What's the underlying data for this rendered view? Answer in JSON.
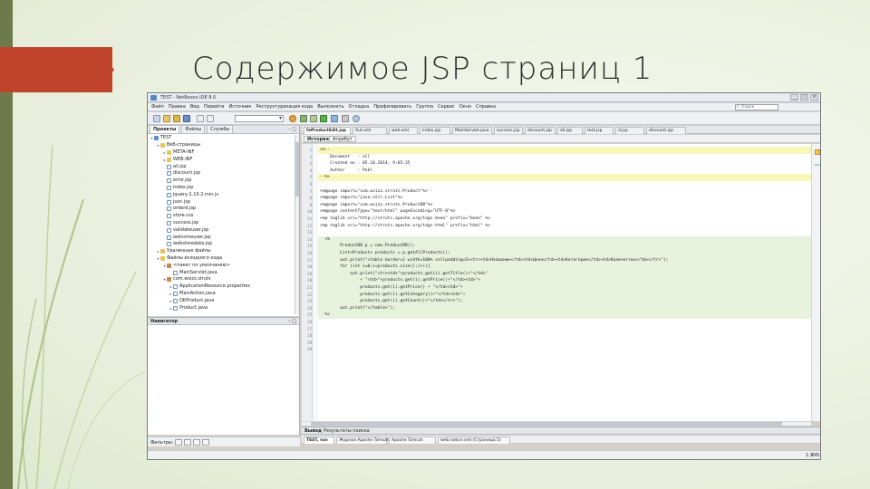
{
  "slide": {
    "title": "Содержимое JSP страниц 1",
    "accent_color": "#c0442b",
    "background_color": "#ecf1e0"
  },
  "ide": {
    "window_title": "TEST - NetBeans IDE 8.0",
    "menu": [
      "Файл",
      "Правка",
      "Вид",
      "Перейти",
      "Источник",
      "Реструктуризация кода",
      "Выполнить",
      "Отладка",
      "Профилировать",
      "Группа",
      "Сервис",
      "Окно",
      "Справка"
    ],
    "search_placeholder": "Поиск",
    "window_buttons": [
      "_",
      "□",
      "×"
    ],
    "left_tabs": [
      "Проекты",
      "Файлы",
      "Службы"
    ],
    "tree": [
      {
        "indent": 0,
        "twisty": "▾",
        "icon": "proj",
        "label": "TEST"
      },
      {
        "indent": 1,
        "twisty": "▾",
        "icon": "folder",
        "label": "Веб-страницы"
      },
      {
        "indent": 2,
        "twisty": "▸",
        "icon": "folder",
        "label": "META-INF"
      },
      {
        "indent": 2,
        "twisty": "▸",
        "icon": "folder",
        "label": "WEB-INF"
      },
      {
        "indent": 2,
        "twisty": "",
        "icon": "file",
        "label": "all.jsp"
      },
      {
        "indent": 2,
        "twisty": "",
        "icon": "file",
        "label": "discount.jsp"
      },
      {
        "indent": 2,
        "twisty": "",
        "icon": "file",
        "label": "error.jsp"
      },
      {
        "indent": 2,
        "twisty": "",
        "icon": "file",
        "label": "index.jsp"
      },
      {
        "indent": 2,
        "twisty": "",
        "icon": "file",
        "label": "jquery-1.10.2.min.js"
      },
      {
        "indent": 2,
        "twisty": "",
        "icon": "file",
        "label": "json.jsp"
      },
      {
        "indent": 2,
        "twisty": "",
        "icon": "file",
        "label": "orderd.jsp"
      },
      {
        "indent": 2,
        "twisty": "",
        "icon": "file",
        "label": "store.css"
      },
      {
        "indent": 2,
        "twisty": "",
        "icon": "file",
        "label": "success.jsp"
      },
      {
        "indent": 2,
        "twisty": "",
        "icon": "file",
        "label": "validateuser.jsp"
      },
      {
        "indent": 2,
        "twisty": "",
        "icon": "file",
        "label": "welcomeuser.jsp"
      },
      {
        "indent": 2,
        "twisty": "",
        "icon": "file",
        "label": "webstoredata.jsp"
      },
      {
        "indent": 1,
        "twisty": "▸",
        "icon": "folder",
        "label": "Удаленные файлы"
      },
      {
        "indent": 1,
        "twisty": "▾",
        "icon": "folder",
        "label": "Файлы исходного кода"
      },
      {
        "indent": 2,
        "twisty": "▾",
        "icon": "pkg",
        "label": "<пакет по умолчанию>"
      },
      {
        "indent": 3,
        "twisty": "",
        "icon": "file",
        "label": "MainServlet.java"
      },
      {
        "indent": 2,
        "twisty": "▾",
        "icon": "pkg",
        "label": "com.wsizz.struts"
      },
      {
        "indent": 3,
        "twisty": "▸",
        "icon": "file",
        "label": "ApplicationResource.properties"
      },
      {
        "indent": 3,
        "twisty": "▸",
        "icon": "file",
        "label": "MainAction.java"
      },
      {
        "indent": 3,
        "twisty": "▸",
        "icon": "file",
        "label": "OKProduct.java"
      },
      {
        "indent": 3,
        "twisty": "▸",
        "icon": "file",
        "label": "Product.java"
      }
    ],
    "navigator_title": "Навигатор",
    "filter_label": "Фильтры:",
    "editor_tabs": [
      "feProductEdit.jsp",
      "Aut.xml",
      "web.xml",
      "index.jsp",
      "MainServlet.java",
      "success.jsp",
      "discount.jsp",
      "all.jsp",
      "test.jsp",
      "d.jsp",
      "discount.jsp"
    ],
    "editor_view_tabs": [
      "История",
      "Атрибут"
    ],
    "line_numbers": [
      "1",
      "2",
      "3",
      "4",
      "5",
      "6",
      "7",
      "8",
      "9",
      "10",
      "11",
      "12",
      "13",
      "14",
      "15",
      "16",
      "17",
      "18",
      "19",
      "20",
      "21",
      "22",
      "23",
      "24",
      "25",
      "26",
      "27",
      "28",
      "29",
      "30"
    ],
    "code_lines": [
      {
        "text": "<%--",
        "cls": "hl-yellow"
      },
      {
        "text": "    Document   : all",
        "cls": ""
      },
      {
        "text": "    Created on : 05.10.2014, 9:05:35",
        "cls": ""
      },
      {
        "text": "    Author     : Pekl",
        "cls": ""
      },
      {
        "text": "--%>",
        "cls": "hl-yellow"
      },
      {
        "text": "",
        "cls": ""
      },
      {
        "text": "<%@page import=\"com.wsizz.struts.Product\"%>",
        "cls": ""
      },
      {
        "text": "<%@page import=\"java.util.List\"%>",
        "cls": ""
      },
      {
        "text": "<%@page import=\"com.wsizz.struts.ProductDB\"%>",
        "cls": ""
      },
      {
        "text": "<%@page contentType=\"text/html\" pageEncoding=\"UTF-8\"%>",
        "cls": ""
      },
      {
        "text": "<%@ taglib uri=\"http://struts.apache.org/tags-bean\" prefix=\"bean\" %>",
        "cls": ""
      },
      {
        "text": "<%@ taglib uri=\"http://struts.apache.org/tags-html\" prefix=\"html\" %>",
        "cls": ""
      },
      {
        "text": "",
        "cls": ""
      },
      {
        "text": "  <%",
        "cls": "hl-green"
      },
      {
        "text": "        ProductDB p = new ProductDB();",
        "cls": "hl-green"
      },
      {
        "text": "        List<Product> products = p.getAllProducts();",
        "cls": "hl-green"
      },
      {
        "text": "        out.print(\"<table border=1 width=100% cellpadding=5><tr><td>Название</td><td>Цена</td><td>Категория</td><td>Количество</td></tr>\");",
        "cls": "hl-green"
      },
      {
        "text": "        for (int i=0;i<products.size();i++){",
        "cls": "hl-green"
      },
      {
        "text": "            out.print(\"<tr><td>\"+products.get(i).getTitle()+\"</td>\"",
        "cls": "hl-green"
      },
      {
        "text": "                + \"<td>\"+products.get(i).getPrice()+\"</td><td>\"+",
        "cls": "hl-green"
      },
      {
        "text": "                products.get(i).getPrice() + \"</td><td>\"+",
        "cls": "hl-green"
      },
      {
        "text": "                products.get(i).getCategory()+\"</td><td>\"+",
        "cls": "hl-green"
      },
      {
        "text": "                products.get(i).getCount()+\"</td></tr>\");",
        "cls": "hl-green"
      },
      {
        "text": "        out.print(\"</table>\");",
        "cls": "hl-green"
      },
      {
        "text": "  %>",
        "cls": "hl-green"
      },
      {
        "text": "",
        "cls": ""
      },
      {
        "text": "",
        "cls": ""
      },
      {
        "text": "",
        "cls": ""
      },
      {
        "text": "",
        "cls": ""
      },
      {
        "text": "",
        "cls": ""
      }
    ],
    "output_header": [
      "Вывод",
      "Результаты поиска"
    ],
    "output_tabs": [
      "TEST, run",
      "Журнал Apache Tomcat",
      "Apache Tomcat",
      "web.notice.xml (Страница 5)"
    ],
    "status_position": "1:1",
    "status_mode": "INS"
  }
}
